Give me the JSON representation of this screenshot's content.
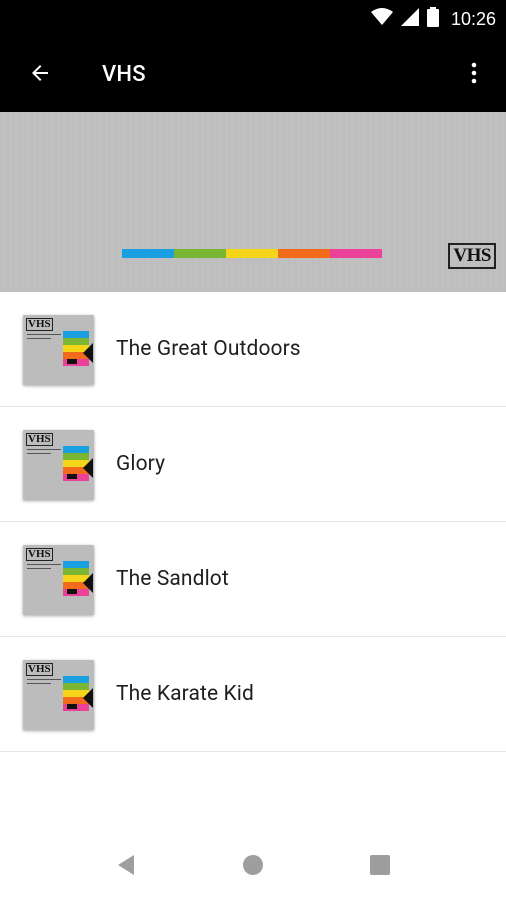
{
  "status_bar": {
    "time": "10:26",
    "icons": [
      "wifi-icon",
      "signal-icon",
      "battery-icon"
    ]
  },
  "app_bar": {
    "title": "VHS",
    "back_icon": "arrow-back-icon",
    "menu_icon": "more-vert-icon"
  },
  "banner": {
    "logo_text": "VHS",
    "stripe_colors": [
      "#1aa0e0",
      "#7ab534",
      "#f5d51a",
      "#f26b1d",
      "#ec4199"
    ]
  },
  "list": {
    "items": [
      {
        "label": "The Great Outdoors",
        "thumb_logo": "VHS"
      },
      {
        "label": "Glory",
        "thumb_logo": "VHS"
      },
      {
        "label": "The Sandlot",
        "thumb_logo": "VHS"
      },
      {
        "label": "The Karate Kid",
        "thumb_logo": "VHS"
      }
    ]
  },
  "nav_bar": {
    "icons": [
      "back-triangle-icon",
      "home-circle-icon",
      "recents-square-icon"
    ]
  },
  "colors": {
    "app_bar": "#000000",
    "banner_gray": "#bfbfbf",
    "text": "#1f1f1f",
    "divider": "#e6e6e6"
  }
}
